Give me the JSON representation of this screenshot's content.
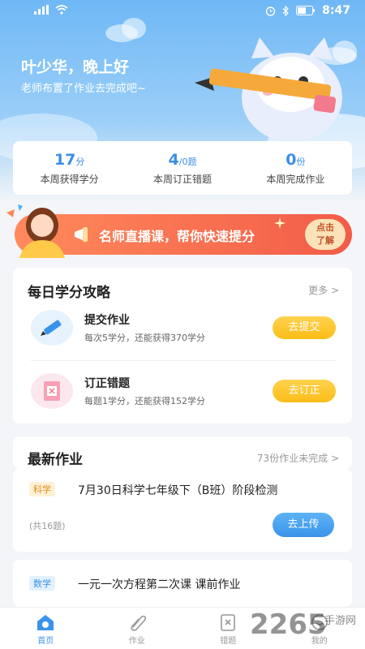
{
  "statusbar": {
    "time": "8:47"
  },
  "header": {
    "greeting": "叶少华，晚上好",
    "subtitle": "老师布置了作业去完成吧~"
  },
  "stats": [
    {
      "value": "17",
      "unit": "分",
      "label": "本周获得学分"
    },
    {
      "value": "4",
      "unit": "/0题",
      "label": "本周订正错题"
    },
    {
      "value": "0",
      "unit": "份",
      "label": "本周完成作业"
    }
  ],
  "banner": {
    "text": "名师直播课，帮你快速提分",
    "button_line1": "点击",
    "button_line2": "了解"
  },
  "strategy": {
    "title": "每日学分攻略",
    "more": "更多 >",
    "tasks": [
      {
        "title": "提交作业",
        "desc": "每次5学分，还能获得370学分",
        "button": "去提交",
        "icon": "pencil-icon"
      },
      {
        "title": "订正错题",
        "desc": "每题1学分，还能获得152学分",
        "button": "去订正",
        "icon": "notebook-icon"
      }
    ]
  },
  "homework": {
    "title": "最新作业",
    "pending": "73份作业未完成 >",
    "items": [
      {
        "subject": "科学",
        "title": "7月30日科学七年级下（B班）阶段检测",
        "count": "(共16题)",
        "button": "去上传"
      },
      {
        "subject": "数学",
        "title": "一元一次方程第二次课 课前作业"
      }
    ]
  },
  "tabbar": {
    "items": [
      {
        "label": "首页",
        "icon": "home-icon"
      },
      {
        "label": "作业",
        "icon": "clip-icon"
      },
      {
        "label": "错题",
        "icon": "error-book-icon"
      },
      {
        "label": "我的",
        "icon": "profile-icon"
      }
    ]
  },
  "watermark": {
    "number": "2265",
    "text": "手游网"
  },
  "colors": {
    "accent": "#3a93ea",
    "yellow": "#fbbd17",
    "banner": "#f25c48"
  }
}
